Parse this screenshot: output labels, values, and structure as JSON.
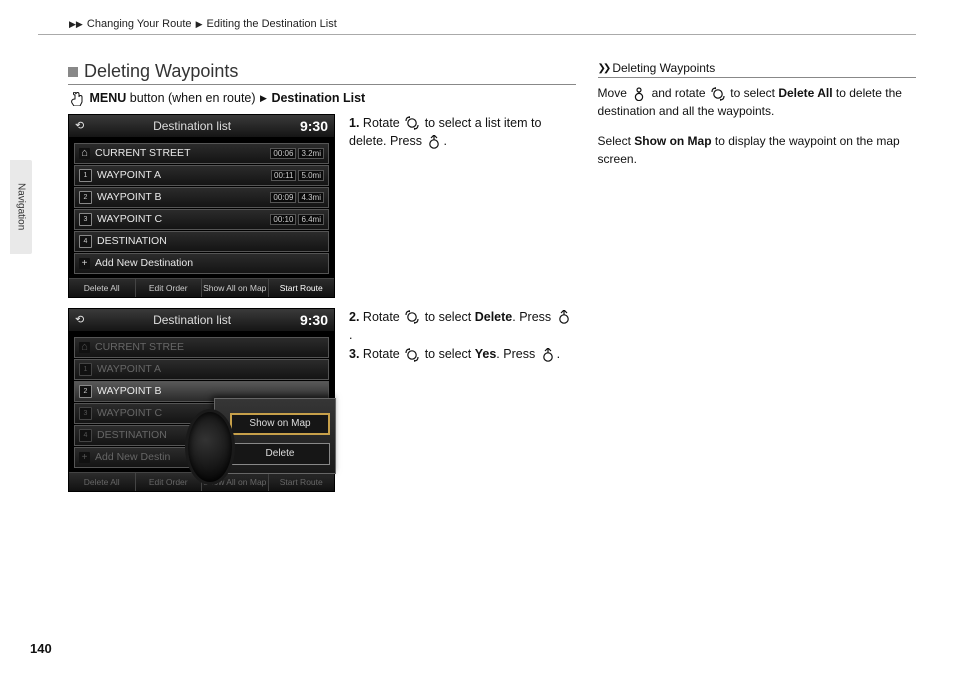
{
  "breadcrumb": {
    "a": "Changing Your Route",
    "b": "Editing the Destination List"
  },
  "sidetab": "Navigation",
  "section_title": "Deleting Waypoints",
  "menu_line": {
    "menu": "MENU",
    "text": " button (when en route) ",
    "dest": "Destination List"
  },
  "nav1": {
    "title": "Destination list",
    "time": "9:30",
    "items": [
      {
        "pin": "home",
        "label": "CURRENT STREET",
        "t": "00:06",
        "d": "3.2mi"
      },
      {
        "pin": "1",
        "label": "WAYPOINT A",
        "t": "00:11",
        "d": "5.0mi"
      },
      {
        "pin": "2",
        "label": "WAYPOINT B",
        "t": "00:09",
        "d": "4.3mi"
      },
      {
        "pin": "3",
        "label": "WAYPOINT C",
        "t": "00:10",
        "d": "6.4mi"
      },
      {
        "pin": "4",
        "label": "DESTINATION",
        "t": "",
        "d": ""
      },
      {
        "pin": "+",
        "label": "Add New Destination",
        "t": "",
        "d": ""
      }
    ],
    "buttons": [
      "Delete All",
      "Edit Order",
      "Show All on Map",
      "Start Route"
    ]
  },
  "nav2": {
    "title": "Destination list",
    "time": "9:30",
    "items_dim": [
      "CURRENT STREE",
      "WAYPOINT A",
      "WAYPOINT B",
      "WAYPOINT C",
      "DESTINATION",
      "Add New Destin"
    ],
    "popup": {
      "opt1": "Show on Map",
      "opt2": "Delete"
    },
    "buttons": [
      "Delete All",
      "Edit Order",
      "Show All on Map",
      "Start Route"
    ]
  },
  "step1": {
    "n": "1.",
    "a": "Rotate ",
    "b": " to select a list item to delete. Press ",
    "c": "."
  },
  "step2": {
    "n": "2.",
    "a": "Rotate ",
    "b": " to select ",
    "bold": "Delete",
    "c": ". Press ",
    "d": "."
  },
  "step3": {
    "n": "3.",
    "a": "Rotate ",
    "b": " to select ",
    "bold": "Yes",
    "c": ". Press ",
    "d": "."
  },
  "tip": {
    "title": "Deleting Waypoints",
    "p1a": "Move ",
    "p1b": " and rotate ",
    "p1c": " to select ",
    "p1bold": "Delete All",
    "p1d": " to delete the destination and all the waypoints.",
    "p2a": "Select ",
    "p2bold": "Show on Map",
    "p2b": " to display the waypoint on the map screen."
  },
  "pagenum": "140"
}
